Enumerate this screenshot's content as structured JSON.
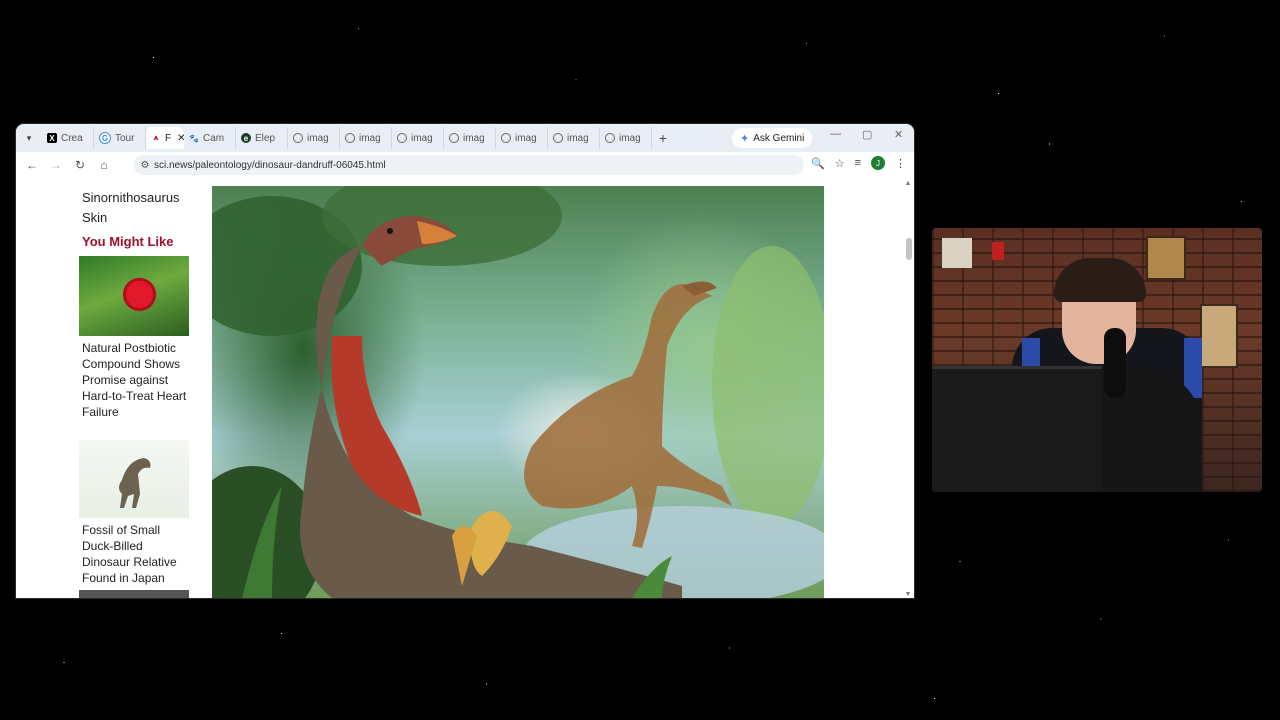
{
  "tabs": [
    {
      "label": "Crea",
      "favicon": "x-logo-icon"
    },
    {
      "label": "Tour",
      "favicon": "google-icon"
    },
    {
      "label": "F",
      "favicon": "sci-news-icon",
      "active": true
    },
    {
      "label": "Cam",
      "favicon": "paw-icon"
    },
    {
      "label": "Elep",
      "favicon": "e-icon"
    },
    {
      "label": "imag",
      "favicon": "globe-icon"
    },
    {
      "label": "imag",
      "favicon": "globe-icon"
    },
    {
      "label": "imag",
      "favicon": "globe-icon"
    },
    {
      "label": "imag",
      "favicon": "globe-icon"
    },
    {
      "label": "imag",
      "favicon": "globe-icon"
    },
    {
      "label": "imag",
      "favicon": "globe-icon"
    },
    {
      "label": "imag",
      "favicon": "globe-icon"
    }
  ],
  "gemini_label": "Ask Gemini",
  "url": "sci.news/paleontology/dinosaur-dandruff-06045.html",
  "profile_initial": "J",
  "sidebar": {
    "heading": "Sinornithosaurus Skin",
    "section_title": "You Might Like",
    "items": [
      {
        "title": "Natural Postbiotic Compound Shows Promise against Hard-to-Treat Heart Failure"
      },
      {
        "title": "Fossil of Small Duck-Billed Dinosaur Relative Found in Japan"
      }
    ]
  },
  "colors": {
    "accent_red": "#a0102a",
    "tab_bar": "#e9eef6"
  }
}
